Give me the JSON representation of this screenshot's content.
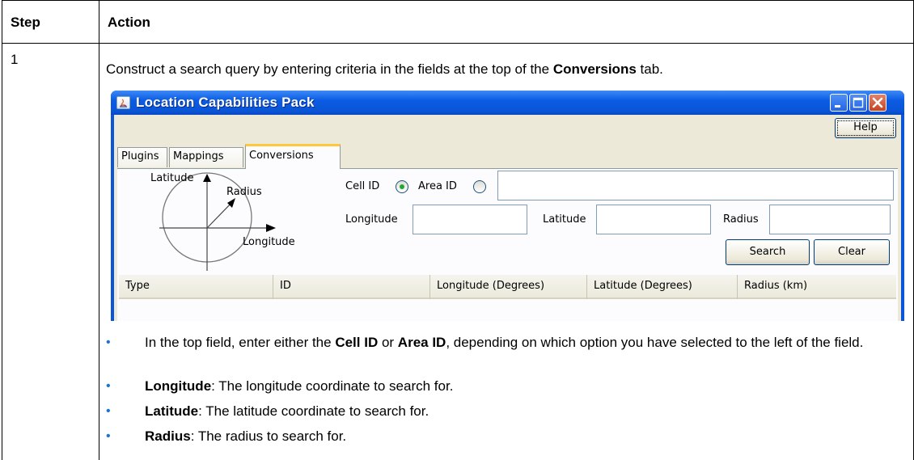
{
  "table": {
    "header": {
      "step": "Step",
      "action": "Action"
    },
    "step_number": "1",
    "instruction": {
      "prefix": "Construct a search query by entering criteria in the fields at the top of the ",
      "bold": "Conversions",
      "suffix": " tab."
    }
  },
  "app": {
    "title": "Location Capabilities Pack",
    "help_label": "Help",
    "tabs": [
      {
        "label": "Plugins",
        "active": false
      },
      {
        "label": "Mappings",
        "active": false
      },
      {
        "label": "Conversions",
        "active": true
      }
    ],
    "diagram": {
      "latitude": "Latitude",
      "radius": "Radius",
      "longitude": "Longitude"
    },
    "form": {
      "cell_id_label": "Cell ID",
      "cell_id_selected": true,
      "area_id_label": "Area ID",
      "area_id_selected": false,
      "longitude_label": "Longitude",
      "latitude_label": "Latitude",
      "radius_label": "Radius",
      "search_label": "Search",
      "clear_label": "Clear"
    },
    "columns": [
      "Type",
      "ID",
      "Longitude (Degrees)",
      "Latitude (Degrees)",
      "Radius (km)"
    ]
  },
  "bullets": [
    {
      "parts": [
        {
          "text": "In the top field, enter either the ",
          "bold": false
        },
        {
          "text": "Cell ID",
          "bold": true
        },
        {
          "text": " or ",
          "bold": false
        },
        {
          "text": "Area ID",
          "bold": true
        },
        {
          "text": ", depending on which option you have selected to the left of the field.",
          "bold": false
        }
      ]
    },
    {
      "parts": [
        {
          "text": "Longitude",
          "bold": true
        },
        {
          "text": ": The longitude coordinate to search for.",
          "bold": false
        }
      ]
    },
    {
      "parts": [
        {
          "text": "Latitude",
          "bold": true
        },
        {
          "text": ": The latitude coordinate to search for.",
          "bold": false
        }
      ]
    },
    {
      "parts": [
        {
          "text": "Radius",
          "bold": true
        },
        {
          "text": ": The radius to search for.",
          "bold": false
        }
      ]
    }
  ],
  "colors": {
    "bullet": "#1f73c8",
    "titlebar": "#0a54d6",
    "active_tab_accent": "#ffc83c"
  }
}
